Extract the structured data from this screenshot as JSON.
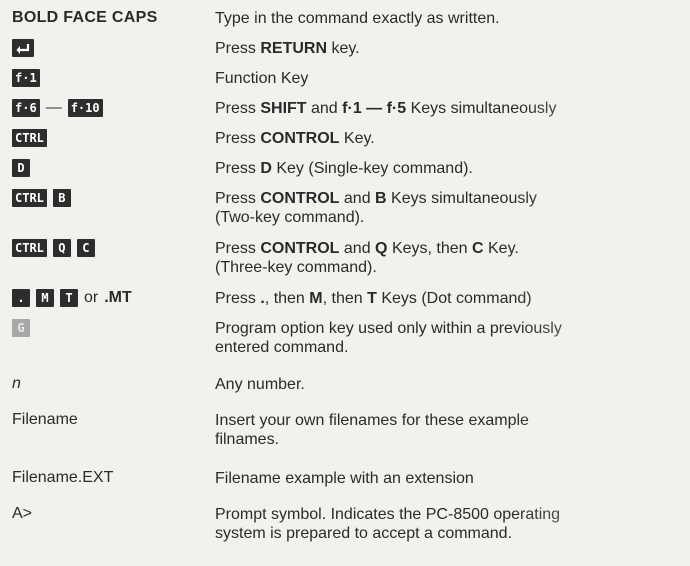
{
  "rows": [
    {
      "col1": {
        "caps": "BOLD FACE CAPS"
      },
      "desc": [
        "Type in the command exactly as written."
      ]
    },
    {
      "col1": {
        "icon": "return-key"
      },
      "desc": [
        {
          "pre": "Press ",
          "bold": "RETURN",
          "post": " key."
        }
      ]
    },
    {
      "col1": {
        "key": "f·1"
      },
      "desc": [
        "Function Key"
      ]
    },
    {
      "col1": {
        "key_a": "f·6",
        "dash": "—",
        "key_b": "f·10"
      },
      "desc": [
        {
          "pre": "Press ",
          "bold1": "SHIFT",
          "mid": " and ",
          "bold2": "f·1 — f·5",
          "post": " Keys simultaneously"
        }
      ]
    },
    {
      "col1": {
        "key": "CTRL"
      },
      "desc": [
        {
          "pre": "Press ",
          "bold": "CONTROL",
          "post": " Key."
        }
      ]
    },
    {
      "col1": {
        "key": "D"
      },
      "desc": [
        {
          "pre": "Press ",
          "bold": "D",
          "post": " Key (Single-key command)."
        }
      ]
    },
    {
      "col1": {
        "key_a": "CTRL",
        "key_b": "B"
      },
      "desc": [
        {
          "pre": "Press ",
          "bold1": "CONTROL",
          "mid": " and ",
          "bold2": "B",
          "post": " Keys simultaneously"
        },
        "(Two-key command)."
      ]
    },
    {
      "col1": {
        "key_a": "CTRL",
        "key_b": "Q",
        "key_c": "C"
      },
      "desc": [
        {
          "pre": "Press ",
          "bold1": "CONTROL",
          "mid": " and ",
          "bold2": "Q",
          "mid2": " Keys, then ",
          "bold3": "C",
          "post": " Key."
        },
        "(Three-key command)."
      ]
    },
    {
      "col1": {
        "key_a": ".",
        "key_b": "M",
        "key_c": "T",
        "or": "or",
        "dot": ".MT"
      },
      "desc": [
        {
          "pre": "Press ",
          "bold1": ".",
          "mid": ", then ",
          "bold2": "M",
          "mid2": ", then ",
          "bold3": "T",
          "post": " Keys (Dot command)"
        }
      ]
    },
    {
      "col1": {
        "key": "G"
      },
      "desc": [
        "Program option key used only within a previously",
        "entered command."
      ]
    },
    {
      "col1": {
        "ital": "n"
      },
      "desc": [
        "Any number."
      ]
    },
    {
      "col1": {
        "text": "Filename"
      },
      "desc": [
        "Insert your own filenames for these example",
        "filnames."
      ]
    },
    {
      "col1": {
        "text": "Filename.EXT"
      },
      "desc": [
        "Filename example with an extension"
      ]
    },
    {
      "col1": {
        "text": "A>"
      },
      "desc": [
        "Prompt symbol. Indicates the PC-8500 operating",
        "system is prepared to accept a command."
      ]
    }
  ]
}
